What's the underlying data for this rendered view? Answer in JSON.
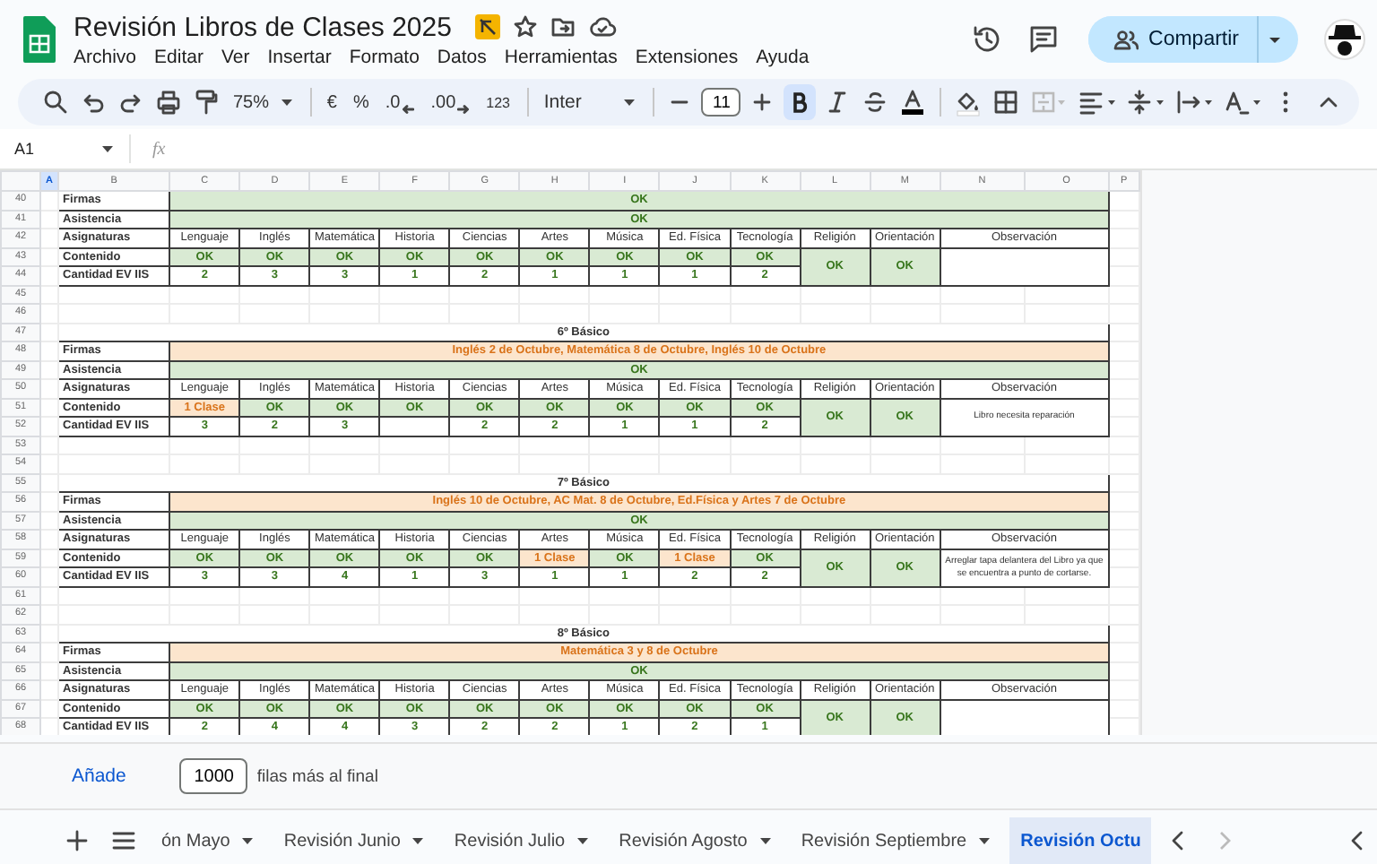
{
  "document": {
    "title": "Revisión Libros de Clases 2025"
  },
  "menu": [
    "Archivo",
    "Editar",
    "Ver",
    "Insertar",
    "Formato",
    "Datos",
    "Herramientas",
    "Extensiones",
    "Ayuda"
  ],
  "share_button": "Compartir",
  "toolbar": {
    "zoom": "75%",
    "currency": "€",
    "percent": "%",
    "decimal_decrease": ".0",
    "decimal_increase": ".00",
    "number_format": "123",
    "font": "Inter",
    "font_size": "11",
    "bold_selected": true,
    "merge_disabled": true
  },
  "formula_bar": {
    "name_box": "A1",
    "function_label": "fx"
  },
  "column_headers": [
    {
      "label": "A",
      "selected": true
    },
    {
      "label": "B",
      "selected": false
    },
    {
      "label": "C",
      "selected": false
    },
    {
      "label": "D",
      "selected": false
    },
    {
      "label": "E",
      "selected": false
    },
    {
      "label": "F",
      "selected": false
    },
    {
      "label": "G",
      "selected": false
    },
    {
      "label": "H",
      "selected": false
    },
    {
      "label": "I",
      "selected": false
    },
    {
      "label": "J",
      "selected": false
    },
    {
      "label": "K",
      "selected": false
    },
    {
      "label": "L",
      "selected": false
    },
    {
      "label": "M",
      "selected": false
    },
    {
      "label": "N",
      "selected": false
    },
    {
      "label": "O",
      "selected": false
    },
    {
      "label": "P",
      "selected": false
    }
  ],
  "row_numbers": [
    "40",
    "41",
    "42",
    "43",
    "44",
    "45",
    "46",
    "47",
    "48",
    "49",
    "50",
    "51",
    "52",
    "53",
    "54",
    "55",
    "56",
    "57",
    "58",
    "59",
    "60",
    "61",
    "62",
    "63",
    "64",
    "65",
    "66",
    "67",
    "68"
  ],
  "blocks": [
    {
      "firmas": {
        "label": "Firmas",
        "value": "OK",
        "pending": false
      },
      "asistencia": {
        "label": "Asistencia",
        "value": "OK",
        "pending": false
      },
      "subjects_label": "Asignaturas",
      "content_label": "Contenido",
      "count_label": "Cantidad EV IIS",
      "subjects": [
        {
          "name": "Lenguaje",
          "content": "OK",
          "pending": false,
          "count": "2"
        },
        {
          "name": "Inglés",
          "content": "OK",
          "pending": false,
          "count": "3"
        },
        {
          "name": "Matemática",
          "content": "OK",
          "pending": false,
          "count": "3"
        },
        {
          "name": "Historia",
          "content": "OK",
          "pending": false,
          "count": "1"
        },
        {
          "name": "Ciencias",
          "content": "OK",
          "pending": false,
          "count": "2"
        },
        {
          "name": "Artes",
          "content": "OK",
          "pending": false,
          "count": "1"
        },
        {
          "name": "Música",
          "content": "OK",
          "pending": false,
          "count": "1"
        },
        {
          "name": "Ed. Física",
          "content": "OK",
          "pending": false,
          "count": "1"
        },
        {
          "name": "Tecnología",
          "content": "OK",
          "pending": false,
          "count": "2"
        }
      ],
      "merged": [
        {
          "name": "Religión",
          "value": "OK"
        },
        {
          "name": "Orientación",
          "value": "OK"
        }
      ],
      "observation": {
        "header": "Observación"
      }
    },
    {
      "title": "6º Básico",
      "firmas": {
        "label": "Firmas",
        "value": "Inglés 2 de Octubre, Matemática 8 de Octubre, Inglés 10 de Octubre",
        "pending": true
      },
      "asistencia": {
        "label": "Asistencia",
        "value": "OK",
        "pending": false
      },
      "subjects_label": "Asignaturas",
      "content_label": "Contenido",
      "count_label": "Cantidad EV IIS",
      "subjects": [
        {
          "name": "Lenguaje",
          "content": "1 Clase",
          "pending": true,
          "count": "3"
        },
        {
          "name": "Inglés",
          "content": "OK",
          "pending": false,
          "count": "2"
        },
        {
          "name": "Matemática",
          "content": "OK",
          "pending": false,
          "count": "3"
        },
        {
          "name": "Historia",
          "content": "OK",
          "pending": false
        },
        {
          "name": "Ciencias",
          "content": "OK",
          "pending": false,
          "count": "2"
        },
        {
          "name": "Artes",
          "content": "OK",
          "pending": false,
          "count": "2"
        },
        {
          "name": "Música",
          "content": "OK",
          "pending": false,
          "count": "1"
        },
        {
          "name": "Ed. Física",
          "content": "OK",
          "pending": false,
          "count": "1"
        },
        {
          "name": "Tecnología",
          "content": "OK",
          "pending": false,
          "count": "2"
        }
      ],
      "merged": [
        {
          "name": "Religión",
          "value": "OK"
        },
        {
          "name": "Orientación",
          "value": "OK"
        }
      ],
      "observation": {
        "header": "Observación",
        "text": "Libro necesita reparación"
      }
    },
    {
      "title": "7º Básico",
      "firmas": {
        "label": "Firmas",
        "value": "Inglés 10 de Octubre, AC Mat. 8 de Octubre, Ed.Física y Artes 7 de Octubre",
        "pending": true
      },
      "asistencia": {
        "label": "Asistencia",
        "value": "OK",
        "pending": false
      },
      "subjects_label": "Asignaturas",
      "content_label": "Contenido",
      "count_label": "Cantidad EV IIS",
      "subjects": [
        {
          "name": "Lenguaje",
          "content": "OK",
          "pending": false,
          "count": "3"
        },
        {
          "name": "Inglés",
          "content": "OK",
          "pending": false,
          "count": "3"
        },
        {
          "name": "Matemática",
          "content": "OK",
          "pending": false,
          "count": "4"
        },
        {
          "name": "Historia",
          "content": "OK",
          "pending": false,
          "count": "1"
        },
        {
          "name": "Ciencias",
          "content": "OK",
          "pending": false,
          "count": "3"
        },
        {
          "name": "Artes",
          "content": "1 Clase",
          "pending": true,
          "count": "1"
        },
        {
          "name": "Música",
          "content": "OK",
          "pending": false,
          "count": "1"
        },
        {
          "name": "Ed. Física",
          "content": "1 Clase",
          "pending": true,
          "count": "2"
        },
        {
          "name": "Tecnología",
          "content": "OK",
          "pending": false,
          "count": "2"
        }
      ],
      "merged": [
        {
          "name": "Religión",
          "value": "OK"
        },
        {
          "name": "Orientación",
          "value": "OK"
        }
      ],
      "observation": {
        "header": "Observación",
        "text": "Arreglar tapa delantera del Libro ya que se encuentra a punto de cortarse."
      }
    },
    {
      "title": "8º Básico",
      "firmas": {
        "label": "Firmas",
        "value": "Matemática 3 y 8 de Octubre",
        "pending": true
      },
      "asistencia": {
        "label": "Asistencia",
        "value": "OK",
        "pending": false
      },
      "subjects_label": "Asignaturas",
      "content_label": "Contenido",
      "count_label": "Cantidad EV IIS",
      "subjects": [
        {
          "name": "Lenguaje",
          "content": "OK",
          "pending": false,
          "count": "2"
        },
        {
          "name": "Inglés",
          "content": "OK",
          "pending": false,
          "count": "4"
        },
        {
          "name": "Matemática",
          "content": "OK",
          "pending": false,
          "count": "4"
        },
        {
          "name": "Historia",
          "content": "OK",
          "pending": false,
          "count": "3"
        },
        {
          "name": "Ciencias",
          "content": "OK",
          "pending": false,
          "count": "2"
        },
        {
          "name": "Artes",
          "content": "OK",
          "pending": false,
          "count": "2"
        },
        {
          "name": "Música",
          "content": "OK",
          "pending": false,
          "count": "1"
        },
        {
          "name": "Ed. Física",
          "content": "OK",
          "pending": false,
          "count": "2"
        },
        {
          "name": "Tecnología",
          "content": "OK",
          "pending": false,
          "count": "1"
        }
      ],
      "merged": [
        {
          "name": "Religión",
          "value": "OK"
        },
        {
          "name": "Orientación",
          "value": "OK"
        }
      ],
      "observation": {
        "header": "Observación"
      }
    }
  ],
  "add_rows": {
    "button": "Añade",
    "value": "1000",
    "suffix": "filas más al final"
  },
  "sheet_tabs": [
    {
      "label": "ón Mayo",
      "selected": false
    },
    {
      "label": "Revisión Junio",
      "selected": false
    },
    {
      "label": "Revisión Julio",
      "selected": false
    },
    {
      "label": "Revisión Agosto",
      "selected": false
    },
    {
      "label": "Revisión Septiembre",
      "selected": false
    },
    {
      "label": "Revisión Octu",
      "selected": true
    }
  ]
}
